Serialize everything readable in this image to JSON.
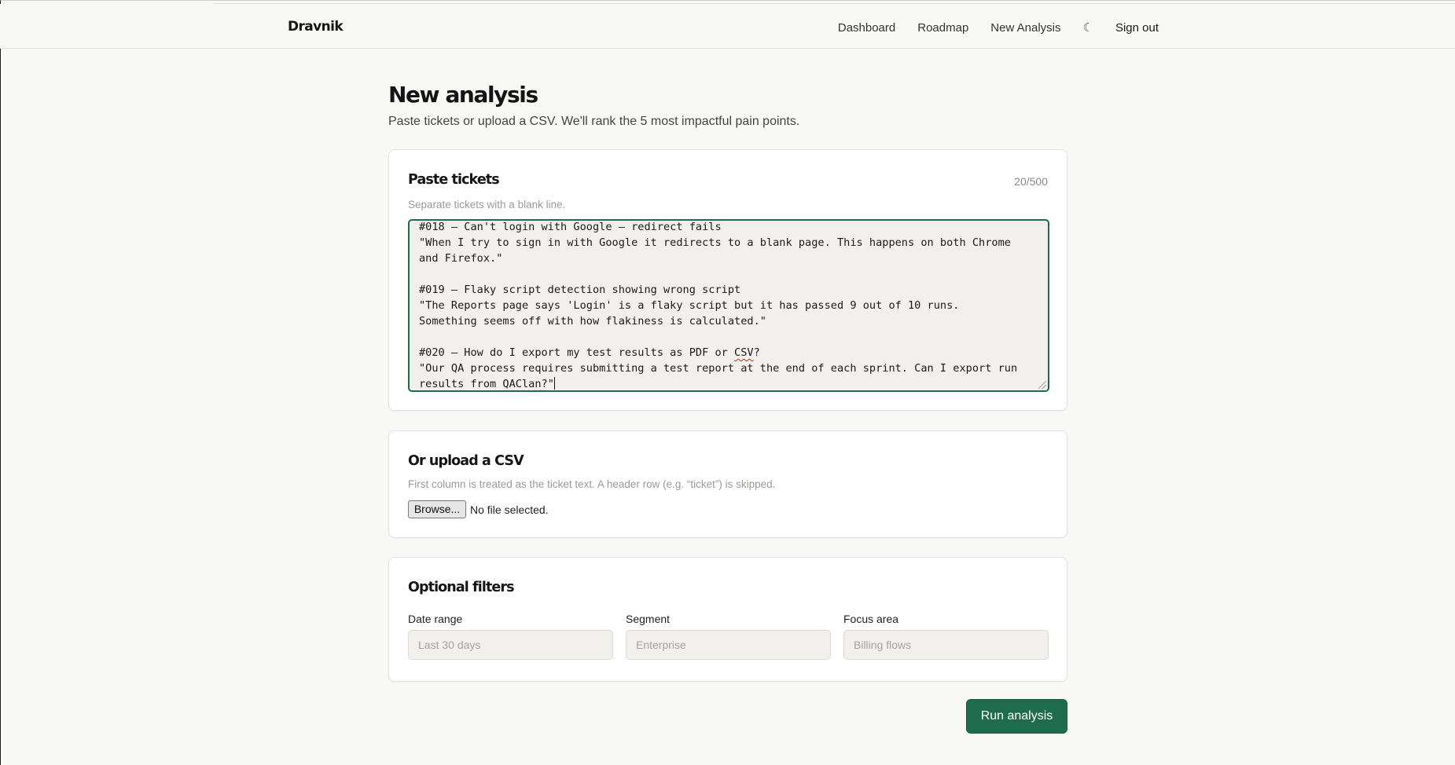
{
  "app": {
    "brand": "Dravnik",
    "nav": {
      "dashboard": "Dashboard",
      "roadmap": "Roadmap",
      "new_analysis": "New Analysis",
      "theme_toggle": "☾",
      "sign_out": "Sign out"
    }
  },
  "page": {
    "title": "New analysis",
    "subtitle": "Paste tickets or upload a CSV. We'll rank the 5 most impactful pain points."
  },
  "paste_card": {
    "title": "Paste tickets",
    "hint": "Separate tickets with a blank line.",
    "counter": "20/500",
    "lines": [
      "#018 — Can't login with Google — redirect fails",
      "\"When I try to sign in with Google it redirects to a blank page. This happens on both Chrome",
      "and Firefox.\"",
      "",
      "#019 — Flaky script detection showing wrong script",
      "\"The Reports page says 'Login' is a flaky script but it has passed 9 out of 10 runs.",
      "Something seems off with how flakiness is calculated.\"",
      "",
      "#020 — How do I export my test results as PDF or CSV?",
      "\"Our QA process requires submitting a test report at the end of each sprint. Can I export run",
      "results from QAClan?\""
    ]
  },
  "upload_card": {
    "title": "Or upload a CSV",
    "hint": "First column is treated as the ticket text. A header row (e.g. “ticket”) is skipped.",
    "browse_label": "Browse...",
    "file_status": "No file selected."
  },
  "filters_card": {
    "title": "Optional filters",
    "date_range": {
      "label": "Date range",
      "placeholder": "Last 30 days"
    },
    "segment": {
      "label": "Segment",
      "placeholder": "Enterprise"
    },
    "focus_area": {
      "label": "Focus area",
      "placeholder": "Billing flows"
    }
  },
  "actions": {
    "run_label": "Run analysis"
  },
  "colors": {
    "accent": "#1f6b4f",
    "background": "#f8f8f6",
    "input_bg": "#f1f0ed"
  }
}
